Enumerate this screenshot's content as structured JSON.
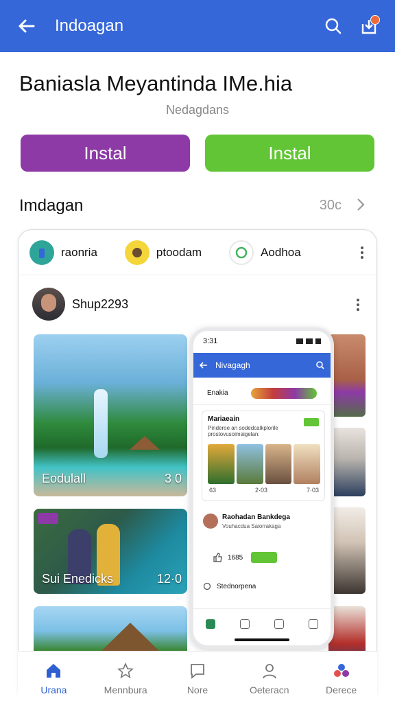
{
  "topbar": {
    "title": "Indoagan",
    "bg_color": "#3567d9"
  },
  "app": {
    "title": "Baniasla Meyantinda IMe.hia",
    "subtitle": "Nedagdans"
  },
  "buttons": {
    "primary": "Instal",
    "secondary": "Instal",
    "primary_color": "#8d3aa6",
    "secondary_color": "#62c536"
  },
  "section": {
    "title": "Imdagan",
    "count": "30c"
  },
  "preview": {
    "stories": [
      {
        "label": "raonria",
        "icon": "lighthouse-icon"
      },
      {
        "label": "ptoodam",
        "icon": "face-icon"
      },
      {
        "label": "Aodhoa",
        "icon": "whatsapp-icon"
      }
    ],
    "user": "Shup2293",
    "tiles": [
      {
        "label": "Eodulall",
        "number": "3 0"
      },
      {
        "label": "Sui Enedicks",
        "number": "12·0"
      }
    ],
    "phone": {
      "time": "3:31",
      "bar_title": "Nivagagh",
      "story_label": "Enakia",
      "card_title": "Mariaeain",
      "card_desc": "Pinderoe an sodedcalkplorile prostovusoimaigelan:",
      "meta": [
        "63",
        "2·03",
        "7·03"
      ],
      "post_name": "Raohadan Bankdega",
      "post_sub": "Vouhacdua Saiorrakaga",
      "likes": "1685",
      "comment": "Stednorpena"
    }
  },
  "bottom_nav": [
    {
      "label": "Urana",
      "icon": "home-icon",
      "active": true
    },
    {
      "label": "Mennbura",
      "icon": "star-icon",
      "active": false
    },
    {
      "label": "Nore",
      "icon": "chat-icon",
      "active": false
    },
    {
      "label": "Oeteracn",
      "icon": "person-icon",
      "active": false
    },
    {
      "label": "Derece",
      "icon": "apps-icon",
      "active": false
    }
  ]
}
